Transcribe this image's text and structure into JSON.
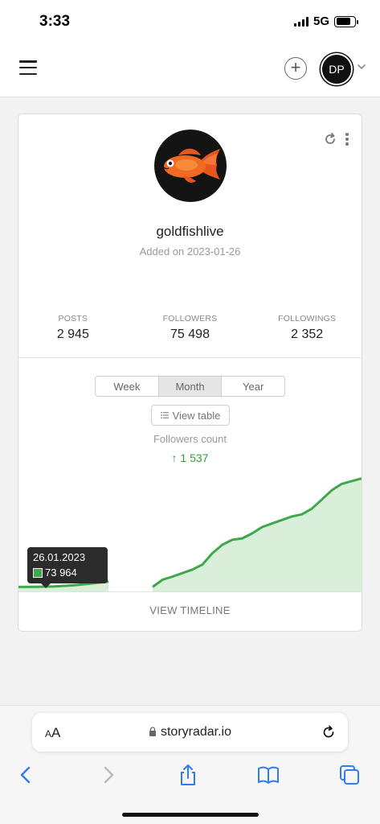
{
  "status_bar": {
    "time": "3:33",
    "network": "5G",
    "battery_level": 0.78
  },
  "header": {
    "avatar_initials": "DP",
    "icons": [
      "menu-icon",
      "plus-circle-icon",
      "chevron-down-icon"
    ]
  },
  "profile": {
    "username": "goldfishlive",
    "added": "Added on 2023-01-26",
    "stats": [
      {
        "label": "POSTS",
        "value": "2 945"
      },
      {
        "label": "FOLLOWERS",
        "value": "75 498"
      },
      {
        "label": "FOLLOWINGS",
        "value": "2 352"
      }
    ]
  },
  "chart_controls": {
    "periods": [
      "Week",
      "Month",
      "Year"
    ],
    "active_period": "Month",
    "view_table": "View table",
    "metric_label": "Followers count",
    "metric_delta": "↑ 1 537"
  },
  "chart_data": {
    "type": "area",
    "grid": false,
    "legend": "none",
    "accent_color": "#3ea84a",
    "fill_color": "#d9efd9",
    "y_range": [
      73900,
      75550
    ],
    "segments": [
      [
        73964,
        73966,
        73970,
        73985,
        74010,
        74040
      ],
      [
        73964,
        74066,
        74110,
        74160,
        74210,
        74280,
        74440,
        74560,
        74630,
        74650,
        74720,
        74810,
        74860,
        74910,
        74960,
        74990,
        75070,
        75200,
        75330,
        75420,
        75460,
        75498
      ]
    ],
    "tooltip": {
      "date": "26.01.2023",
      "value": "73 964"
    }
  },
  "timeline_button": "VIEW TIMELINE",
  "browser": {
    "aa_small": "A",
    "aa_large": "A",
    "url": "storyradar.io"
  }
}
